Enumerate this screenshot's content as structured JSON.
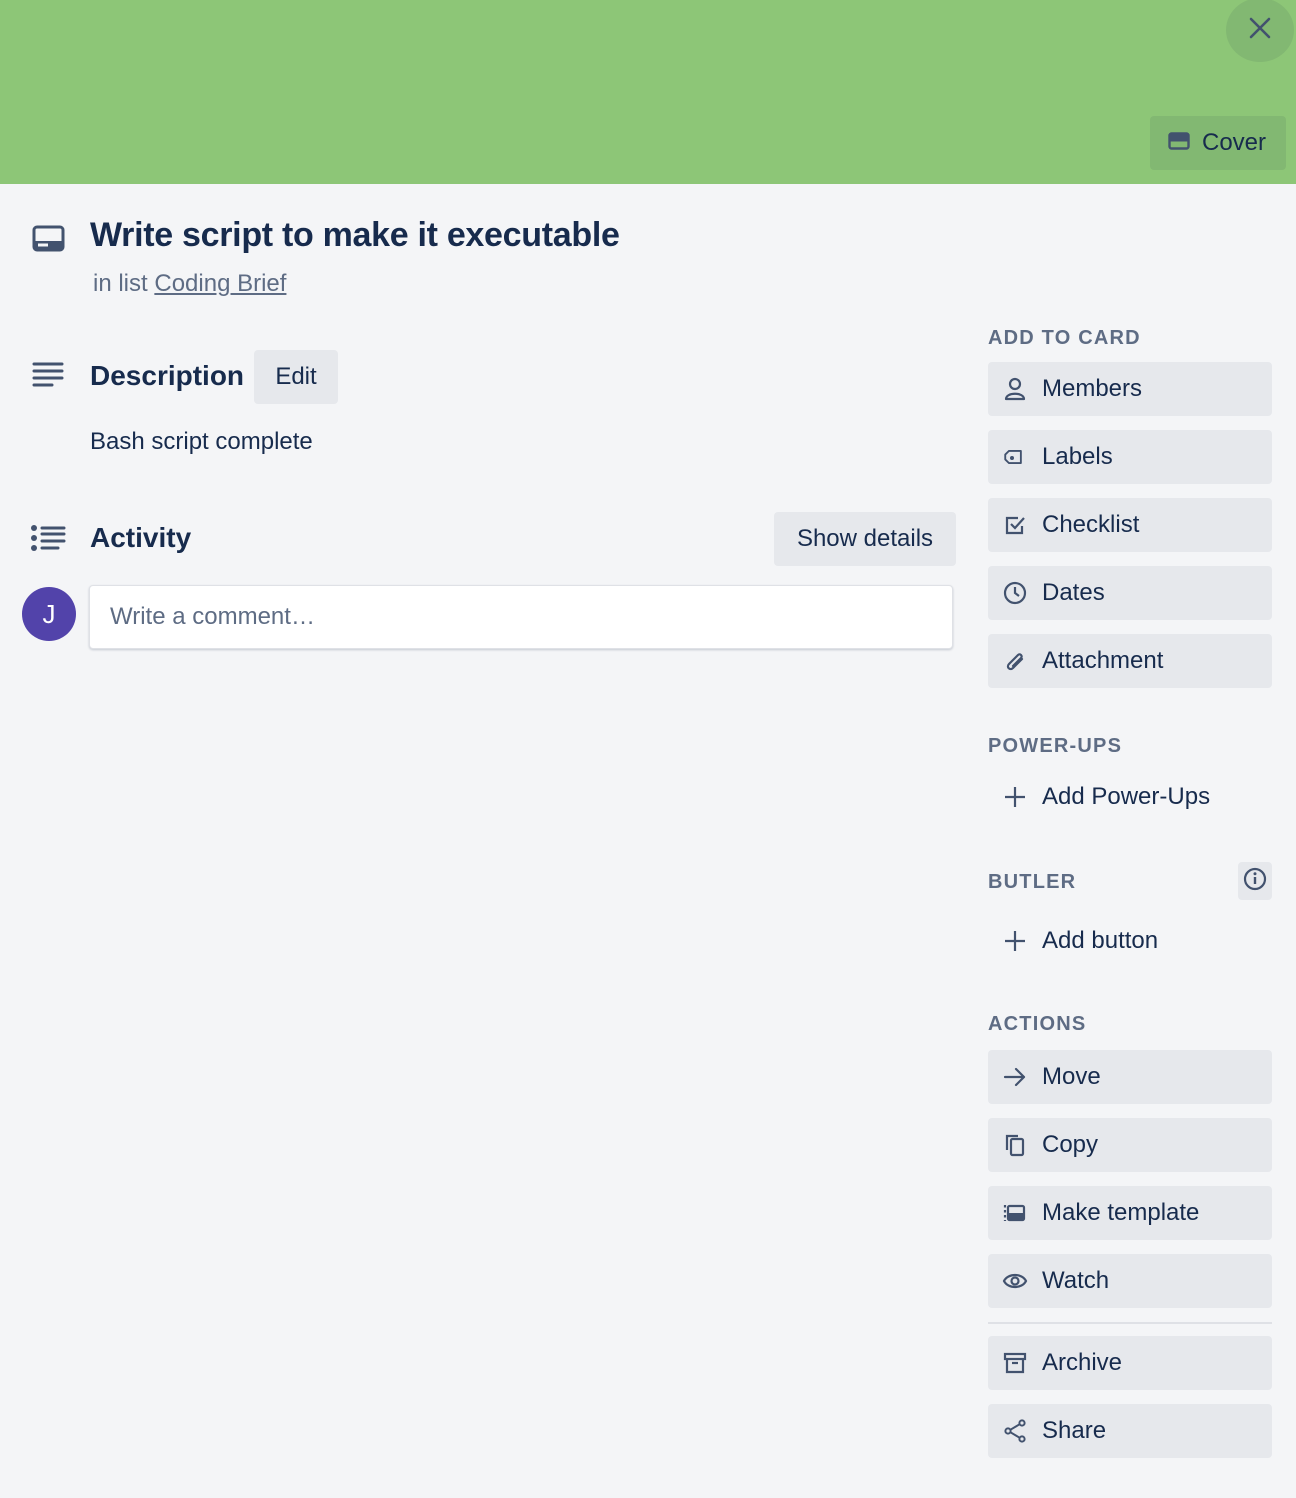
{
  "cover": {
    "color": "#8dc677",
    "button_label": "Cover",
    "button_icon": "card-cover-icon"
  },
  "close": {
    "icon": "close-icon"
  },
  "card": {
    "title": "Write script to make it executable",
    "in_list_prefix": "in list",
    "list_name": "Coding Brief"
  },
  "description": {
    "heading": "Description",
    "edit_label": "Edit",
    "text": "Bash script complete"
  },
  "activity": {
    "heading": "Activity",
    "show_details_label": "Show details",
    "avatar_initial": "J",
    "avatar_color": "#5243aa",
    "comment_placeholder": "Write a comment…"
  },
  "sidebar": {
    "add_to_card": {
      "label": "ADD TO CARD",
      "items": [
        {
          "label": "Members",
          "icon": "person-icon"
        },
        {
          "label": "Labels",
          "icon": "label-tag-icon"
        },
        {
          "label": "Checklist",
          "icon": "checkbox-icon"
        },
        {
          "label": "Dates",
          "icon": "clock-icon"
        },
        {
          "label": "Attachment",
          "icon": "paperclip-icon"
        }
      ]
    },
    "power_ups": {
      "label": "POWER-UPS",
      "add_label": "Add Power-Ups"
    },
    "butler": {
      "label": "BUTLER",
      "add_label": "Add button"
    },
    "actions": {
      "label": "ACTIONS",
      "items": [
        {
          "label": "Move",
          "icon": "arrow-right-icon"
        },
        {
          "label": "Copy",
          "icon": "copy-icon"
        },
        {
          "label": "Make template",
          "icon": "template-icon"
        },
        {
          "label": "Watch",
          "icon": "eye-icon"
        },
        {
          "label": "Archive",
          "icon": "archive-icon"
        },
        {
          "label": "Share",
          "icon": "share-icon"
        }
      ]
    }
  }
}
